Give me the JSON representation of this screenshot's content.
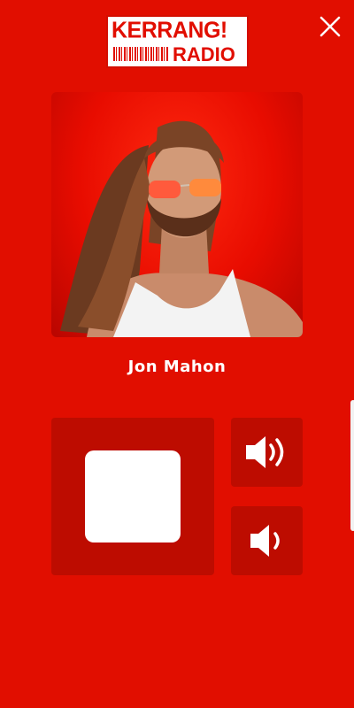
{
  "header": {
    "logo_line1": "KERRANG!",
    "logo_line2": "RADIO"
  },
  "now_playing": {
    "presenter_name": "Jon Mahon"
  },
  "controls": {
    "stop_icon": "stop-icon",
    "volume_up_icon": "volume-up-icon",
    "volume_down_icon": "volume-down-icon",
    "close_icon": "close-icon"
  },
  "colors": {
    "background": "#e10e00",
    "panel": "#bd0c00",
    "foreground": "#ffffff"
  }
}
